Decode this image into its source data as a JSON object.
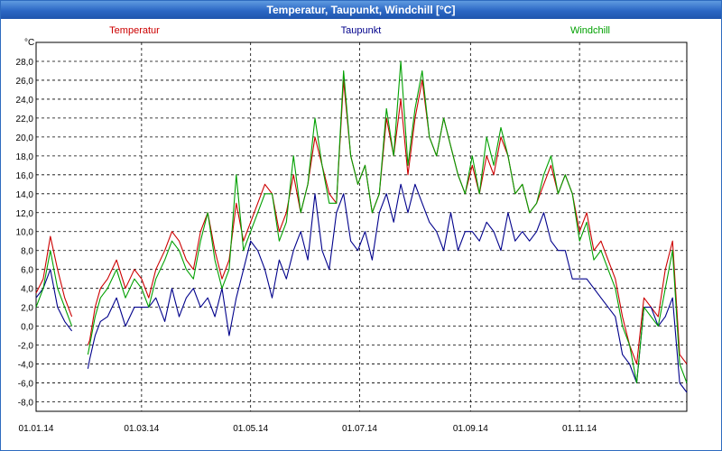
{
  "window": {
    "title": "Temperatur, Taupunkt, Windchill [°C]"
  },
  "chart_data": {
    "type": "line",
    "title": "Temperatur, Taupunkt, Windchill [°C]",
    "ylabel": "°C",
    "ylim": [
      -9,
      30
    ],
    "grid": true,
    "legend_position": "top",
    "y_ticks": [
      "28,0",
      "26,0",
      "24,0",
      "22,0",
      "20,0",
      "18,0",
      "16,0",
      "14,0",
      "12,0",
      "10,0",
      "8,0",
      "6,0",
      "4,0",
      "2,0",
      "0,0",
      "-2,0",
      "-4,0",
      "-6,0",
      "-8,0"
    ],
    "x_ticks": [
      "01.01.14",
      "01.03.14",
      "01.05.14",
      "01.07.14",
      "01.09.14",
      "01.11.14"
    ],
    "x_tick_days": [
      0,
      59,
      120,
      181,
      243,
      304
    ],
    "x_range_days": [
      0,
      364
    ],
    "series": [
      {
        "name": "Temperatur",
        "color": "#cc0000",
        "x": [
          0,
          4,
          8,
          12,
          16,
          20,
          24,
          28,
          29,
          30,
          33,
          36,
          40,
          45,
          50,
          55,
          59,
          63,
          67,
          72,
          76,
          80,
          84,
          88,
          92,
          96,
          100,
          104,
          108,
          112,
          116,
          120,
          124,
          128,
          132,
          136,
          140,
          144,
          148,
          152,
          156,
          160,
          164,
          168,
          172,
          176,
          180,
          184,
          188,
          192,
          196,
          200,
          204,
          208,
          212,
          216,
          220,
          224,
          228,
          232,
          236,
          240,
          244,
          248,
          252,
          256,
          260,
          264,
          268,
          272,
          276,
          280,
          284,
          288,
          292,
          296,
          300,
          304,
          308,
          312,
          316,
          320,
          324,
          328,
          332,
          336,
          340,
          344,
          348,
          352,
          356,
          360,
          364
        ],
        "y": [
          3.5,
          5,
          9.5,
          6,
          3,
          1,
          null,
          null,
          -2,
          -1.5,
          2,
          4,
          5,
          7,
          4,
          6,
          5,
          3,
          6,
          8,
          10,
          9,
          7,
          6,
          10,
          12,
          8,
          5,
          7,
          13,
          9,
          11,
          13,
          15,
          14,
          10,
          12,
          16,
          12,
          15,
          20,
          17,
          14,
          13,
          26,
          18,
          15,
          17,
          12,
          14,
          22,
          18,
          24,
          16,
          22,
          26,
          20,
          18,
          22,
          19,
          16,
          14,
          17,
          14,
          18,
          16,
          20,
          18,
          14,
          15,
          12,
          13,
          15,
          17,
          14,
          16,
          14,
          10,
          12,
          8,
          9,
          7,
          5,
          1,
          -2,
          -4,
          3,
          2,
          1,
          6,
          9,
          -3,
          -4
        ]
      },
      {
        "name": "Taupunkt",
        "color": "#00008b",
        "x": [
          0,
          4,
          8,
          12,
          16,
          20,
          24,
          28,
          29,
          30,
          33,
          36,
          40,
          45,
          50,
          55,
          59,
          63,
          67,
          72,
          76,
          80,
          84,
          88,
          92,
          96,
          100,
          104,
          108,
          112,
          116,
          120,
          124,
          128,
          132,
          136,
          140,
          144,
          148,
          152,
          156,
          160,
          164,
          168,
          172,
          176,
          180,
          184,
          188,
          192,
          196,
          200,
          204,
          208,
          212,
          216,
          220,
          224,
          228,
          232,
          236,
          240,
          244,
          248,
          252,
          256,
          260,
          264,
          268,
          272,
          276,
          280,
          284,
          288,
          292,
          296,
          300,
          304,
          308,
          312,
          316,
          320,
          324,
          328,
          332,
          336,
          340,
          344,
          348,
          352,
          356,
          360,
          364
        ],
        "y": [
          3,
          4,
          6,
          2,
          0.5,
          -0.5,
          null,
          null,
          -4.5,
          -3.5,
          -1,
          0.5,
          1,
          3,
          0,
          2,
          2,
          2,
          3,
          0.5,
          4,
          1,
          3,
          4,
          2,
          3,
          1,
          4,
          -1,
          3,
          6,
          9,
          8,
          6,
          3,
          7,
          5,
          8,
          10,
          7,
          14,
          8,
          6,
          12,
          14,
          9,
          8,
          10,
          7,
          12,
          14,
          11,
          15,
          12,
          15,
          13,
          11,
          10,
          8,
          12,
          8,
          10,
          10,
          9,
          11,
          10,
          8,
          12,
          9,
          10,
          9,
          10,
          12,
          9,
          8,
          8,
          5,
          5,
          5,
          4,
          3,
          2,
          1,
          -3,
          -4,
          -6,
          2,
          2,
          0,
          1,
          3,
          -6,
          -7
        ]
      },
      {
        "name": "Windchill",
        "color": "#00a000",
        "x": [
          0,
          4,
          8,
          12,
          16,
          20,
          24,
          28,
          29,
          30,
          33,
          36,
          40,
          45,
          50,
          55,
          59,
          63,
          67,
          72,
          76,
          80,
          84,
          88,
          92,
          96,
          100,
          104,
          108,
          112,
          116,
          120,
          124,
          128,
          132,
          136,
          140,
          144,
          148,
          152,
          156,
          160,
          164,
          168,
          172,
          176,
          180,
          184,
          188,
          192,
          196,
          200,
          204,
          208,
          212,
          216,
          220,
          224,
          228,
          232,
          236,
          240,
          244,
          248,
          252,
          256,
          260,
          264,
          268,
          272,
          276,
          280,
          284,
          288,
          292,
          296,
          300,
          304,
          308,
          312,
          316,
          320,
          324,
          328,
          332,
          336,
          340,
          344,
          348,
          352,
          356,
          360,
          364
        ],
        "y": [
          2,
          4,
          8,
          4,
          2,
          0,
          null,
          null,
          -3,
          -2,
          1,
          3,
          4,
          6,
          3,
          5,
          4,
          2,
          5,
          7,
          9,
          8,
          6,
          5,
          9,
          12,
          7,
          4,
          6,
          16,
          8,
          10,
          12,
          14,
          14,
          9,
          11,
          18,
          12,
          15,
          22,
          17,
          13,
          13,
          27,
          18,
          15,
          17,
          12,
          14,
          23,
          18,
          28,
          17,
          23,
          27,
          20,
          18,
          22,
          19,
          16,
          14,
          18,
          14,
          20,
          17,
          21,
          18,
          14,
          15,
          12,
          13,
          16,
          18,
          14,
          16,
          14,
          9,
          11,
          7,
          8,
          6,
          4,
          0,
          -2,
          -6,
          2,
          1,
          0,
          4,
          8,
          -4,
          -6
        ]
      }
    ]
  }
}
